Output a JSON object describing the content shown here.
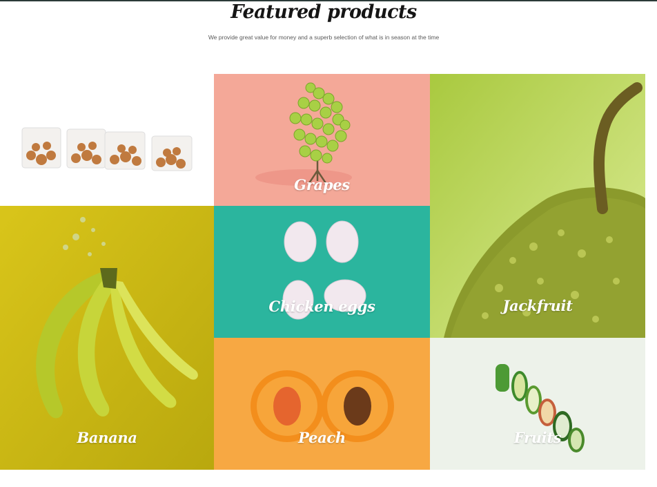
{
  "header": {
    "title": "Featured products",
    "subtitle": "We provide great value for money and a superb selection of what is in season at the time"
  },
  "products": [
    {
      "name": "",
      "image": "cookies-in-bags"
    },
    {
      "name": "Grapes",
      "image": "grapes",
      "bg": "#f4a898"
    },
    {
      "name": "Jackfruit",
      "image": "jackfruit",
      "bg": "#b7cf52"
    },
    {
      "name": "Banana",
      "image": "banana",
      "bg": "#cfbd12"
    },
    {
      "name": "Chicken eggs",
      "image": "eggs",
      "bg": "#2bb59e"
    },
    {
      "name": "Peach",
      "image": "peach",
      "bg": "#f7a843"
    },
    {
      "name": "Fruits",
      "image": "sliced-vegetables",
      "bg": "#edf2ea"
    }
  ]
}
